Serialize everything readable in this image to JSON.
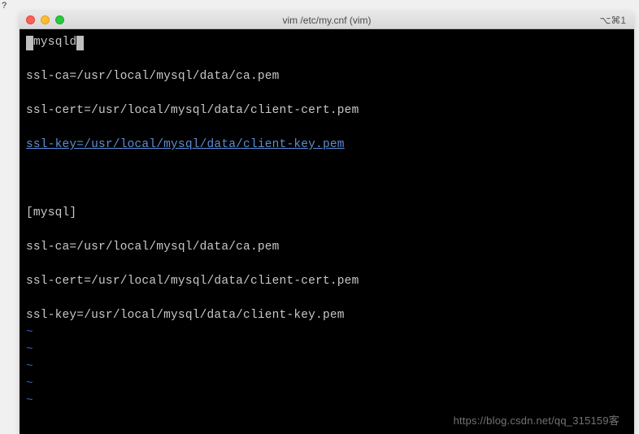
{
  "partial_top": "?",
  "window": {
    "title": "vim /etc/my.cnf (vim)",
    "right_indicator": "⌥⌘1"
  },
  "file": {
    "section1_open": "[",
    "section1_text": "mysqld",
    "section1_close": "]",
    "lines": [
      "",
      "ssl-ca=/usr/local/mysql/data/ca.pem",
      "",
      "ssl-cert=/usr/local/mysql/data/client-cert.pem",
      ""
    ],
    "link_line": "ssl-key=/usr/local/mysql/data/client-key.pem",
    "lines2": [
      "",
      "",
      "",
      "[mysql]",
      "",
      "ssl-ca=/usr/local/mysql/data/ca.pem",
      "",
      "ssl-cert=/usr/local/mysql/data/client-cert.pem",
      "",
      "ssl-key=/usr/local/mysql/data/client-key.pem"
    ],
    "tildes": [
      "~",
      "~",
      "~",
      "~",
      "~"
    ]
  },
  "watermark": "https://blog.csdn.net/qq_315159客"
}
